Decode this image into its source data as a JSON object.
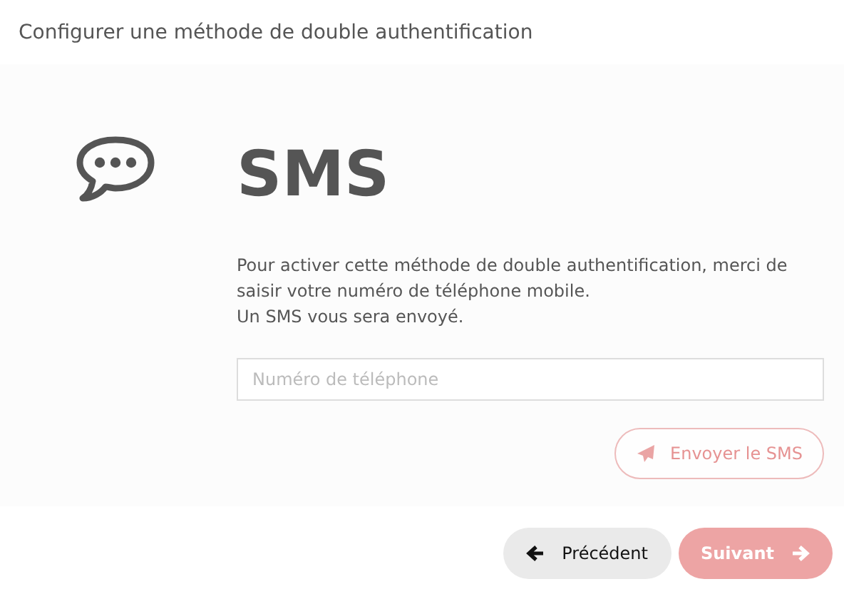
{
  "header": {
    "title": "Configurer une méthode de double authentification"
  },
  "method": {
    "title": "SMS",
    "description": [
      "Pour activer cette méthode de double authentification, merci de saisir votre numéro de téléphone mobile.",
      "Un SMS vous sera envoyé."
    ],
    "phone_field": {
      "placeholder": "Numéro de téléphone"
    },
    "send_button": {
      "label": "Envoyer le SMS",
      "disabled": true
    }
  },
  "footer": {
    "back_button": {
      "label": "Précédent",
      "disabled": false
    },
    "next_button": {
      "label": "Suivant",
      "disabled": true
    }
  }
}
